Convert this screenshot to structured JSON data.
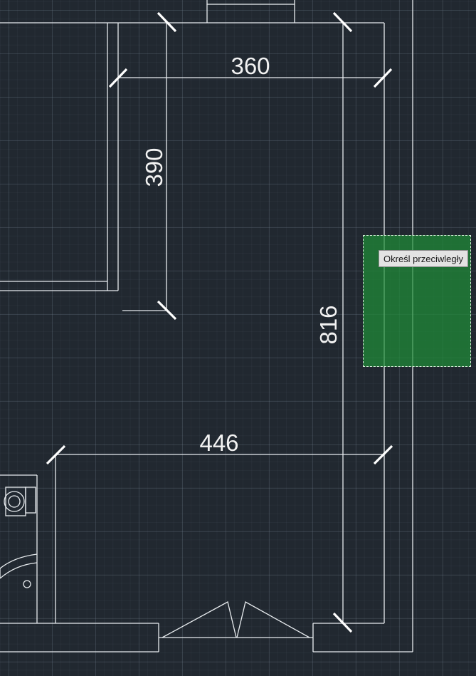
{
  "app": "CAD drawing canvas",
  "colors": {
    "background": "#212830",
    "lines": "#e8ecef",
    "selection_fill": "#1e8c37",
    "tooltip_bg": "#e3e3e3"
  },
  "dimensions": [
    {
      "id": "dim-top",
      "value": "360",
      "orientation": "horizontal"
    },
    {
      "id": "dim-left",
      "value": "390",
      "orientation": "vertical"
    },
    {
      "id": "dim-right",
      "value": "816",
      "orientation": "vertical"
    },
    {
      "id": "dim-bottom",
      "value": "446",
      "orientation": "horizontal"
    }
  ],
  "tooltip": {
    "text": "Określ przeciwległy"
  },
  "cursor_mode": "crossing-window selection"
}
